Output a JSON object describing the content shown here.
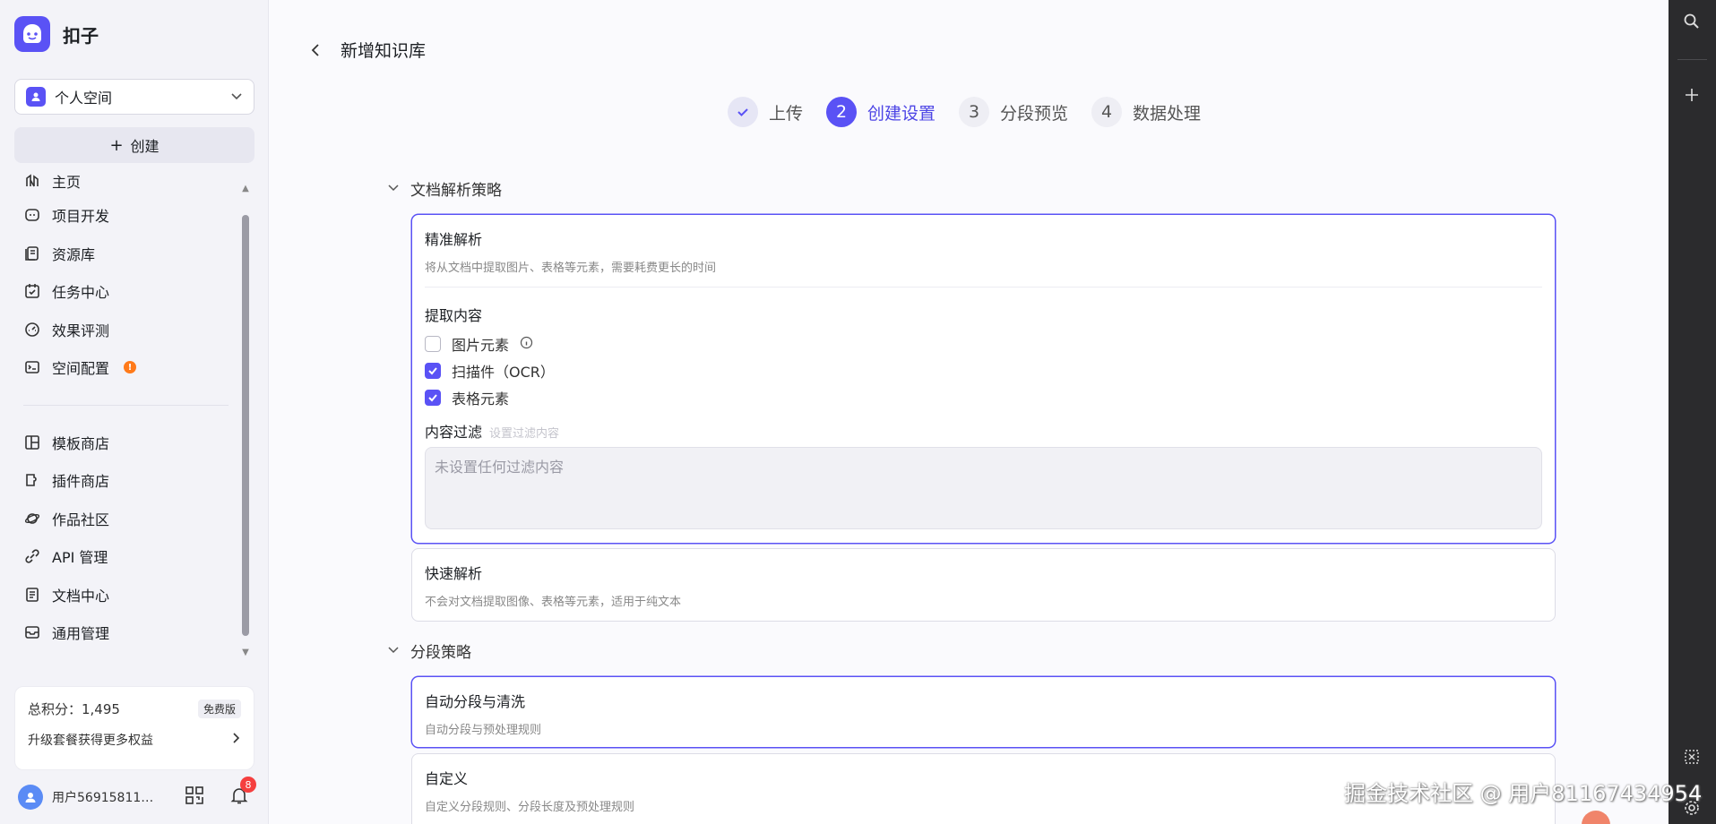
{
  "brand": {
    "name": "扣子"
  },
  "space": {
    "label": "个人空间"
  },
  "create": {
    "label": "创建"
  },
  "nav": {
    "home": "主页",
    "project": "项目开发",
    "library": "资源库",
    "tasks": "任务中心",
    "eval": "效果评测",
    "space_config": "空间配置",
    "space_config_badge": "!",
    "templates": "模板商店",
    "plugins": "插件商店",
    "community": "作品社区",
    "api": "API 管理",
    "docs": "文档中心",
    "general": "通用管理"
  },
  "points": {
    "label": "总积分：1,495",
    "tier": "免费版",
    "upgrade": "升级套餐获得更多权益"
  },
  "user": {
    "name": "用户56915811…",
    "notifications": "8"
  },
  "header": {
    "title": "新增知识库"
  },
  "steps": [
    {
      "num": "",
      "label": "上传"
    },
    {
      "num": "2",
      "label": "创建设置"
    },
    {
      "num": "3",
      "label": "分段预览"
    },
    {
      "num": "4",
      "label": "数据处理"
    }
  ],
  "parse": {
    "section_title": "文档解析策略",
    "precise": {
      "title": "精准解析",
      "desc": "将从文档中提取图片、表格等元素，需要耗费更长的时间",
      "extract_title": "提取内容",
      "options": [
        {
          "label": "图片元素",
          "checked": false
        },
        {
          "label": "扫描件（OCR）",
          "checked": true
        },
        {
          "label": "表格元素",
          "checked": true
        }
      ],
      "filter_label": "内容过滤",
      "filter_hint": "设置过滤内容",
      "filter_placeholder": "未设置任何过滤内容"
    },
    "fast": {
      "title": "快速解析",
      "desc": "不会对文档提取图像、表格等元素，适用于纯文本"
    }
  },
  "segment": {
    "section_title": "分段策略",
    "auto": {
      "title": "自动分段与清洗",
      "desc": "自动分段与预处理规则"
    },
    "custom": {
      "title": "自定义",
      "desc": "自定义分段规则、分段长度及预处理规则"
    }
  },
  "watermark": "掘金技术社区 @ 用户81167434954",
  "colors": {
    "accent": "#5a52f5",
    "badge": "#f53f3f",
    "warning": "#ff7a1a",
    "rail": "#2b2b2d"
  }
}
